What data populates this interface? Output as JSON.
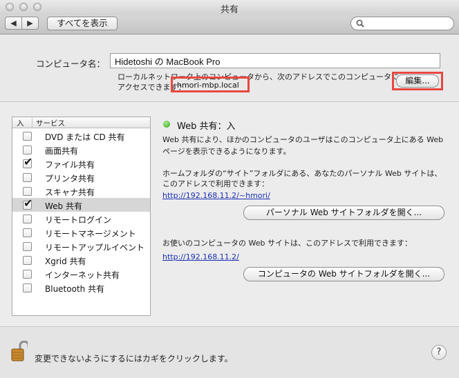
{
  "window": {
    "title": "共有"
  },
  "toolbar": {
    "back_glyph": "◀",
    "forward_glyph": "▶",
    "show_all_label": "すべてを表示",
    "search_placeholder": ""
  },
  "computer_name": {
    "label": "コンピュータ名：",
    "value": "Hidetoshi の MacBook Pro",
    "description_line1": "ローカルネットワーク上のコンピュータから、次のアドレスでこのコンピュータに",
    "description_line2": "アクセスできます：",
    "hostname": "hmori-mbp.local",
    "edit_button": "編集..."
  },
  "service_list": {
    "header_on": "入",
    "header_service": "サービス",
    "items": [
      {
        "label": "DVD または CD 共有",
        "checked": false,
        "selected": false
      },
      {
        "label": "画面共有",
        "checked": false,
        "selected": false
      },
      {
        "label": "ファイル共有",
        "checked": true,
        "selected": false
      },
      {
        "label": "プリンタ共有",
        "checked": false,
        "selected": false
      },
      {
        "label": "スキャナ共有",
        "checked": false,
        "selected": false
      },
      {
        "label": "Web 共有",
        "checked": true,
        "selected": true
      },
      {
        "label": "リモートログイン",
        "checked": false,
        "selected": false
      },
      {
        "label": "リモートマネージメント",
        "checked": false,
        "selected": false
      },
      {
        "label": "リモートアップルイベント",
        "checked": false,
        "selected": false
      },
      {
        "label": "Xgrid 共有",
        "checked": false,
        "selected": false
      },
      {
        "label": "インターネット共有",
        "checked": false,
        "selected": false
      },
      {
        "label": "Bluetooth 共有",
        "checked": false,
        "selected": false
      }
    ]
  },
  "detail": {
    "status_text": "Web 共有：入",
    "status_color": "#2c9e14",
    "desc_line1": "Web 共有により、ほかのコンピュータのユーザはこのコンピュータ上にある Web",
    "desc_line2": "ページを表示できるようになります。",
    "personal_line1": "ホームフォルダの“サイト”フォルダにある、あなたのパーソナル Web サイトは、",
    "personal_line2": "このアドレスで利用できます：",
    "personal_url": "http://192.168.11.2/~hmori/",
    "personal_button": "パーソナル Web サイトフォルダを開く...",
    "computer_line": "お使いのコンピュータの Web サイトは、このアドレスで利用できます：",
    "computer_url": "http://192.168.11.2/",
    "computer_button": "コンピュータの Web サイトフォルダを開く..."
  },
  "footer": {
    "lock_message": "変更できないようにするにはカギをクリックします。",
    "help_glyph": "?"
  }
}
